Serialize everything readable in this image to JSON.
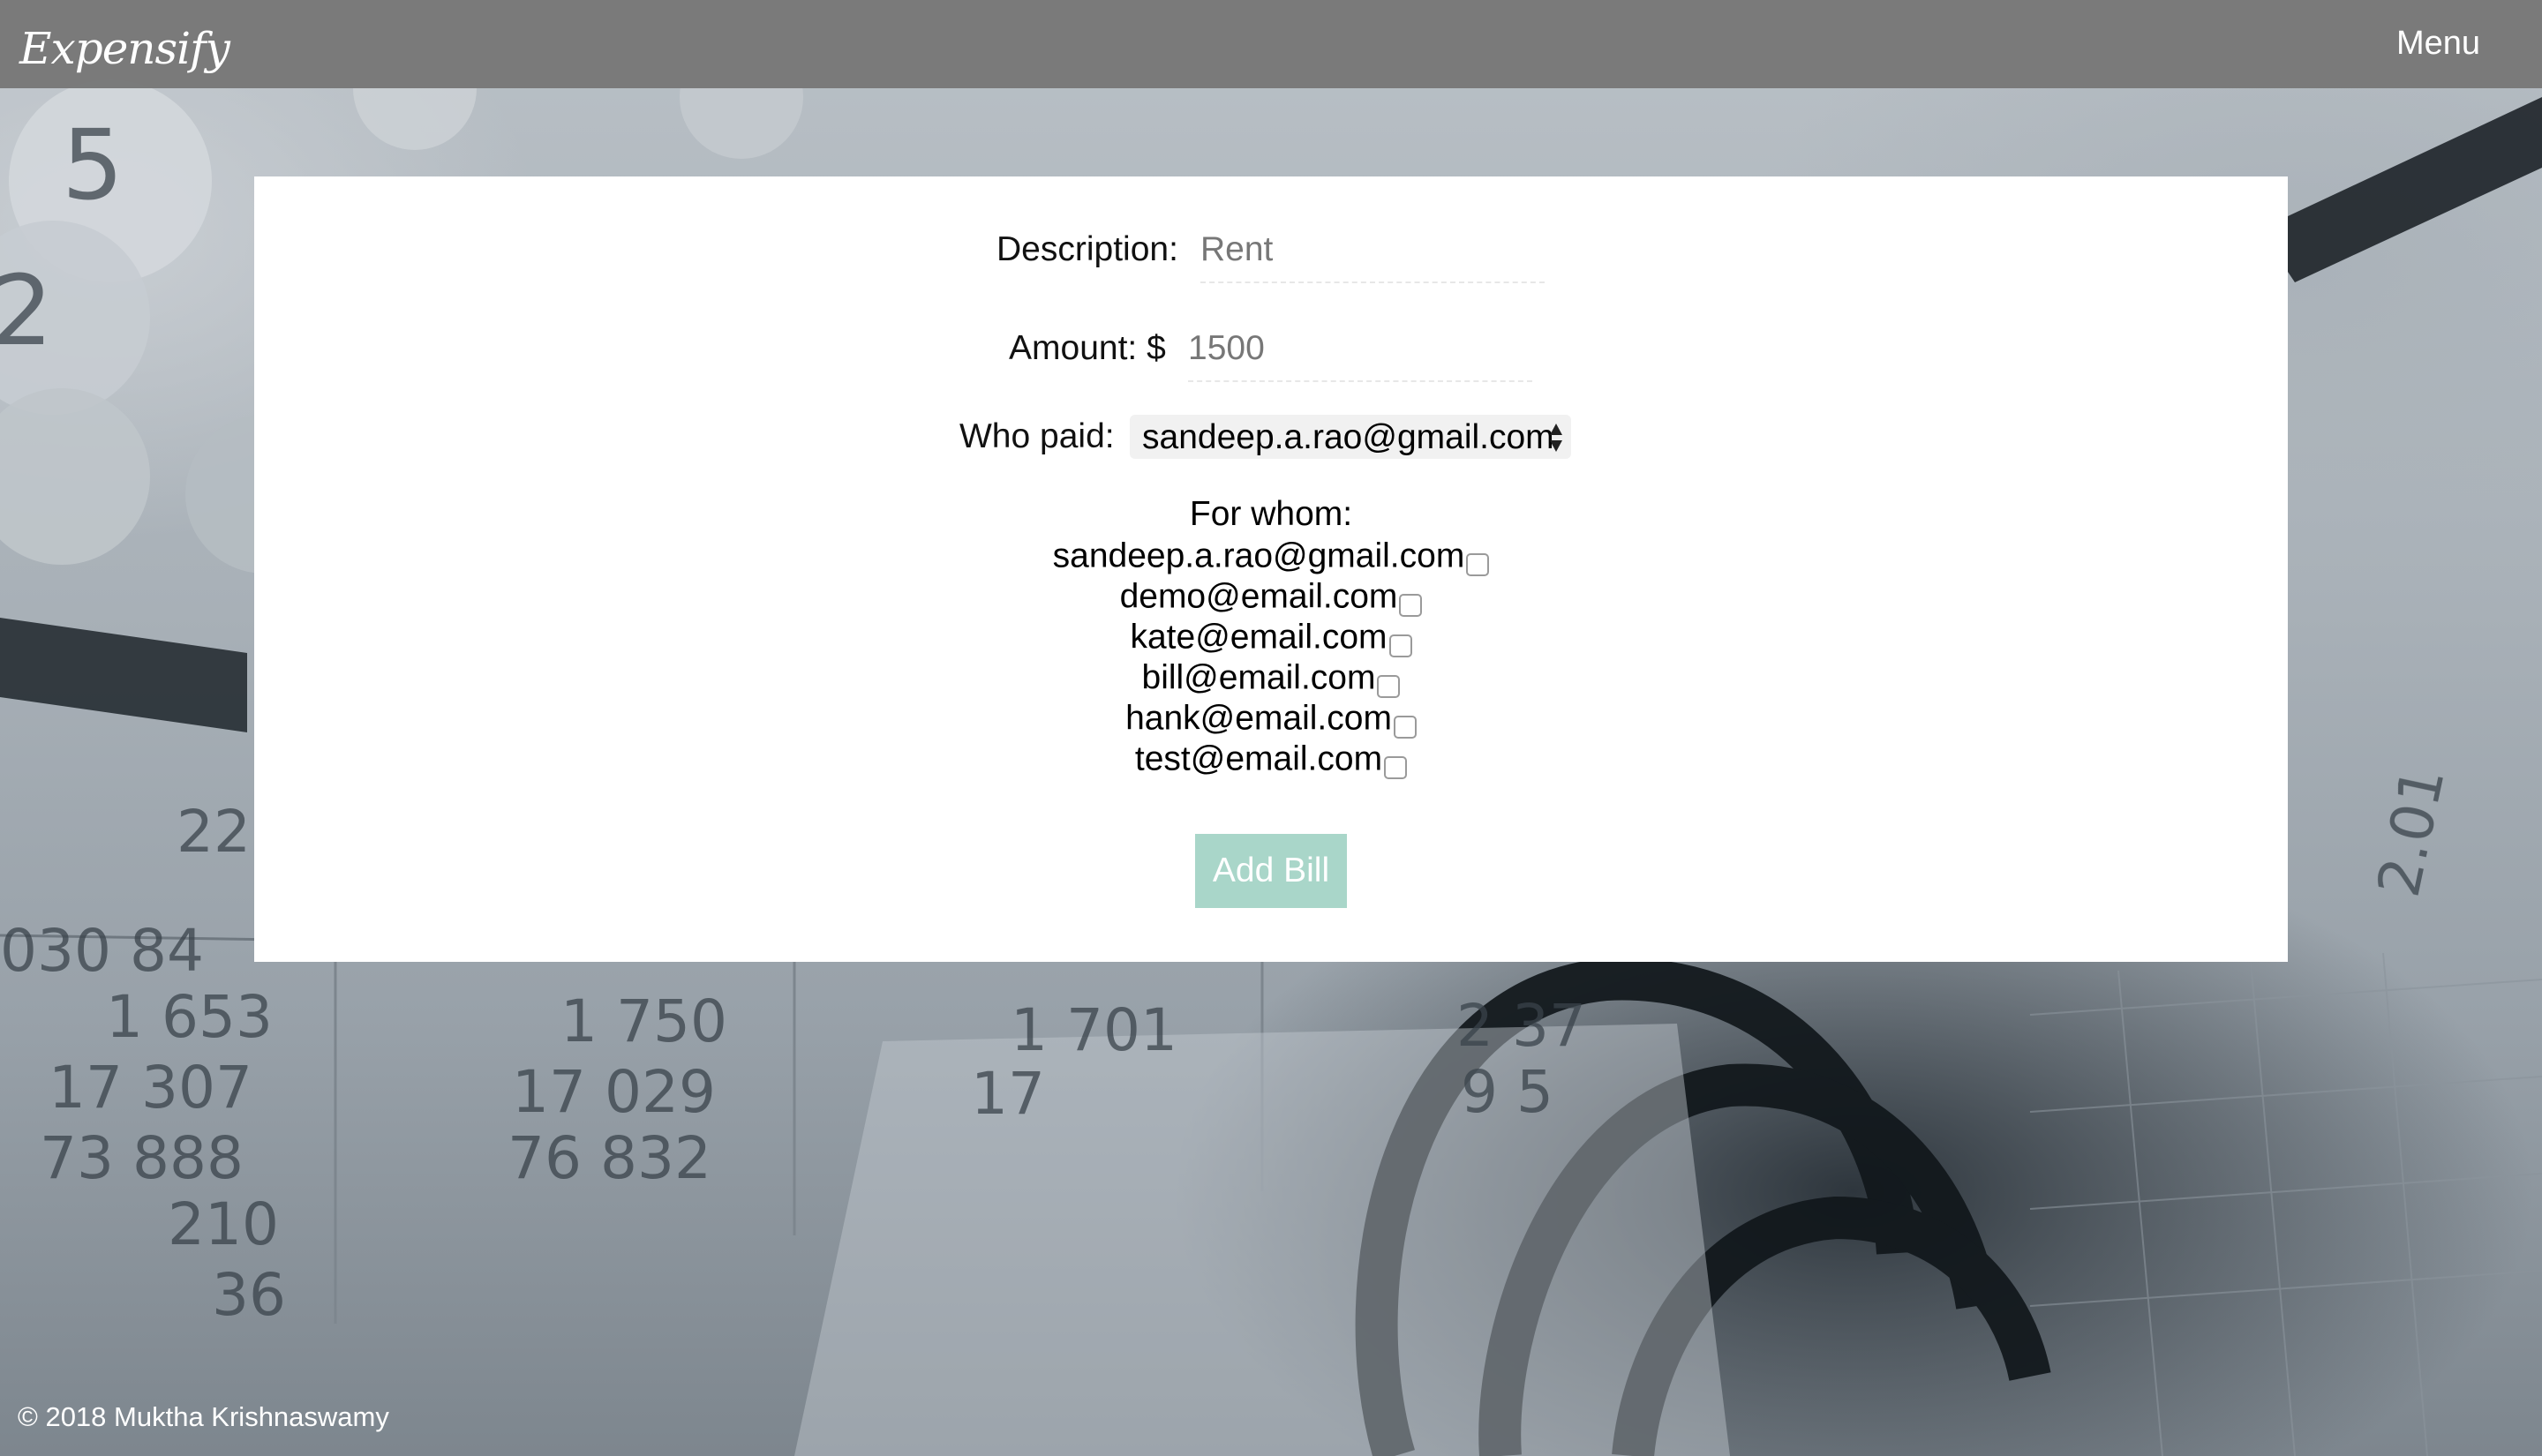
{
  "header": {
    "brand": "Expensify",
    "menu_label": "Menu"
  },
  "form": {
    "description": {
      "label": "Description:",
      "placeholder": "Rent"
    },
    "amount": {
      "label": "Amount: $",
      "placeholder": "1500"
    },
    "who_paid": {
      "label": "Who paid:",
      "selected": "sandeep.a.rao@gmail.com"
    },
    "for_whom": {
      "label": "For whom:",
      "people": [
        {
          "email": "sandeep.a.rao@gmail.com",
          "checked": false
        },
        {
          "email": "demo@email.com",
          "checked": false
        },
        {
          "email": "kate@email.com",
          "checked": false
        },
        {
          "email": "bill@email.com",
          "checked": false
        },
        {
          "email": "hank@email.com",
          "checked": false
        },
        {
          "email": "test@email.com",
          "checked": false
        }
      ]
    },
    "submit_label": "Add Bill"
  },
  "footer": {
    "copyright": "© 2018 Muktha Krishnaswamy"
  },
  "background_numbers": [
    "5",
    "2",
    "22",
    "030 84",
    "1 653",
    "17 307",
    "73 888",
    "210",
    "36",
    "1 750",
    "17 029",
    "76 832",
    "1 701",
    "17",
    "2 37",
    "9 5",
    "2.01"
  ],
  "colors": {
    "topbar": "#787878",
    "card": "#ffffff",
    "button": "#a9d6c9",
    "button_text": "#ffffff"
  },
  "icons": {
    "select_arrows": "updown-triangle-icon"
  }
}
